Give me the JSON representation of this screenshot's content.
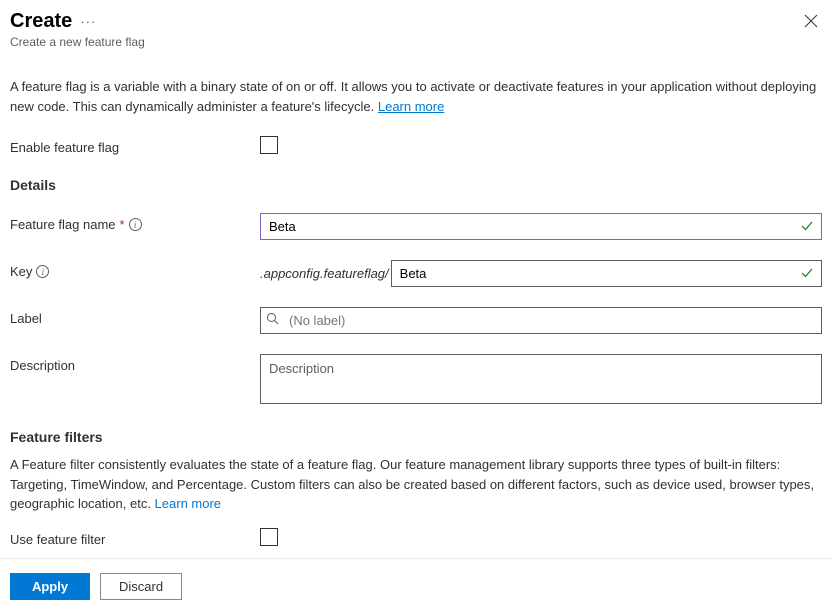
{
  "header": {
    "title": "Create",
    "subtitle": "Create a new feature flag"
  },
  "intro": {
    "text": "A feature flag is a variable with a binary state of on or off. It allows you to activate or deactivate features in your application without deploying new code. This can dynamically administer a feature's lifecycle. ",
    "learn_more": "Learn more"
  },
  "enable": {
    "label": "Enable feature flag",
    "checked": false
  },
  "details": {
    "heading": "Details",
    "name": {
      "label": "Feature flag name",
      "value": "Beta"
    },
    "key": {
      "label": "Key",
      "prefix": ".appconfig.featureflag/",
      "value": "Beta"
    },
    "label_field": {
      "label": "Label",
      "placeholder": "(No label)"
    },
    "description": {
      "label": "Description",
      "placeholder": "Description",
      "value": ""
    }
  },
  "filters": {
    "heading": "Feature filters",
    "text": "A Feature filter consistently evaluates the state of a feature flag. Our feature management library supports three types of built-in filters: Targeting, TimeWindow, and Percentage. Custom filters can also be created based on different factors, such as device used, browser types, geographic location, etc. ",
    "learn_more": "Learn more",
    "use_label": "Use feature filter",
    "use_checked": false
  },
  "footer": {
    "apply": "Apply",
    "discard": "Discard"
  }
}
